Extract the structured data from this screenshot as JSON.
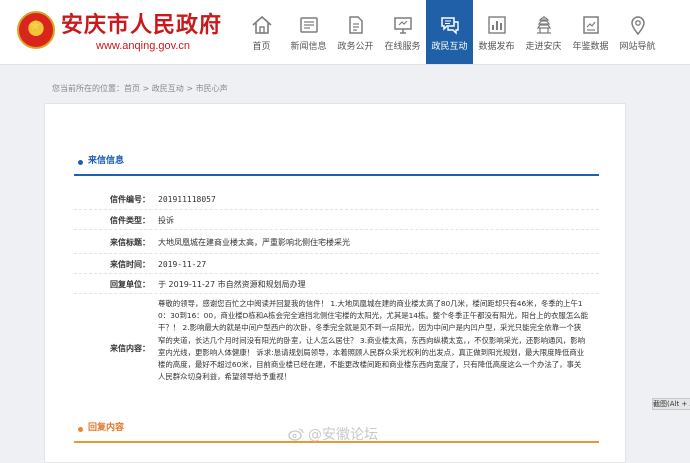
{
  "header": {
    "site_title": "安庆市人民政府",
    "site_url": "www.anqing.gov.cn",
    "nav": [
      {
        "label": "首页",
        "icon": "home-icon"
      },
      {
        "label": "新闻信息",
        "icon": "newspaper-icon"
      },
      {
        "label": "政务公开",
        "icon": "document-icon"
      },
      {
        "label": "在线服务",
        "icon": "monitor-icon"
      },
      {
        "label": "政民互动",
        "icon": "chat-icon",
        "active": true
      },
      {
        "label": "数据发布",
        "icon": "bar-chart-icon"
      },
      {
        "label": "走进安庆",
        "icon": "pagoda-icon"
      },
      {
        "label": "年鉴数据",
        "icon": "yearbook-icon"
      },
      {
        "label": "网站导航",
        "icon": "location-pin-icon"
      }
    ],
    "accent_color": "#2060a8"
  },
  "breadcrumb": "您当前所在的位置：首页 > 政民互动 > 市民心声",
  "letter": {
    "section_title": "来信信息",
    "fields": {
      "number_label": "信件编号：",
      "number": "201911118057",
      "type_label": "信件类型：",
      "type": "投诉",
      "subject_label": "来信标题：",
      "subject": "大地凤凰城在建商业楼太高，严重影响北侧住宅楼采光",
      "date_label": "来信时间：",
      "date": "2019-11-27",
      "status_label": "回复单位：",
      "status": "于 2019-11-27  市自然资源和规划局办理",
      "content_label": "来信内容：",
      "content": "尊敬的领导，感谢您百忙之中阅读并回复我的信件！ 1.大地凤凰城在建的商业楼太高了80几米，楼间距却只有46米，冬季的上午10：30到16：00，商业楼D栋和A栋会完全遮挡北侧住宅楼的太阳光，尤其是14栋。整个冬季正午都没有阳光，阳台上的衣服怎么能干？！ 2.影响最大的就是中间户型西户的次卧，冬季完全就是见不到一点阳光，因为中间户是内凹户型，采光只能完全依靠一个狭窄的夹道，长达几个月时间没有阳光的卧室，让人怎么居住？ 3.商业楼太高，东西向纵横太宽，，不仅影响采光，还影响通风，影响室内光线，更影响人体健康！ 诉求:恳请规划局领导，本着照顾人民群众采光权利的出发点，真正做到阳光规划，最大限度降低商业楼的高度，最好不超过60米，目前商业楼已经在建，不能更改楼间距和商业楼东西向宽度了，只有降低高度这么一个办法了，事关人民群众切身利益，希望领导给予重视！"
    }
  },
  "reply": {
    "section_title": "回复内容"
  },
  "side_button": "截图(Alt + A)",
  "watermark": "@安徽论坛"
}
